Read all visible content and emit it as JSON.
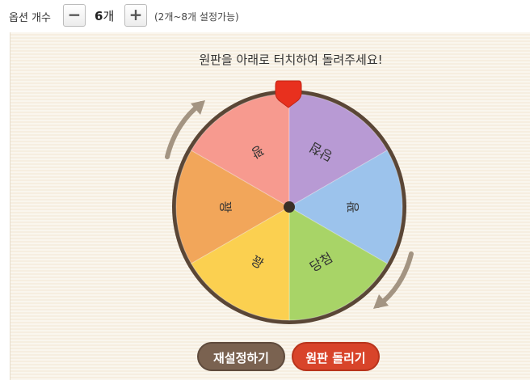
{
  "topbar": {
    "option_label": "옵션 개수",
    "minus_symbol": "−",
    "count_value": "6",
    "count_unit": "개",
    "plus_symbol": "+",
    "range_hint": "(2개~8개 설정가능)"
  },
  "instruction": "원판을 아래로 터치하여 돌려주세요!",
  "wheel": {
    "segments": [
      {
        "label": "꽝",
        "color": "#f2a65a"
      },
      {
        "label": "꽝",
        "color": "#f79a8f"
      },
      {
        "label": "당첨",
        "color": "#b89ad4"
      },
      {
        "label": "꽝",
        "color": "#9cc3ec"
      },
      {
        "label": "당첨",
        "color": "#a8d467"
      },
      {
        "label": "꽝",
        "color": "#fbd050"
      }
    ],
    "rim_color": "#5a4636",
    "pointer_color": "#e8301e",
    "arrow_color": "#a39482"
  },
  "buttons": {
    "reset_label": "재설정하기",
    "spin_label": "원판 돌리기"
  }
}
